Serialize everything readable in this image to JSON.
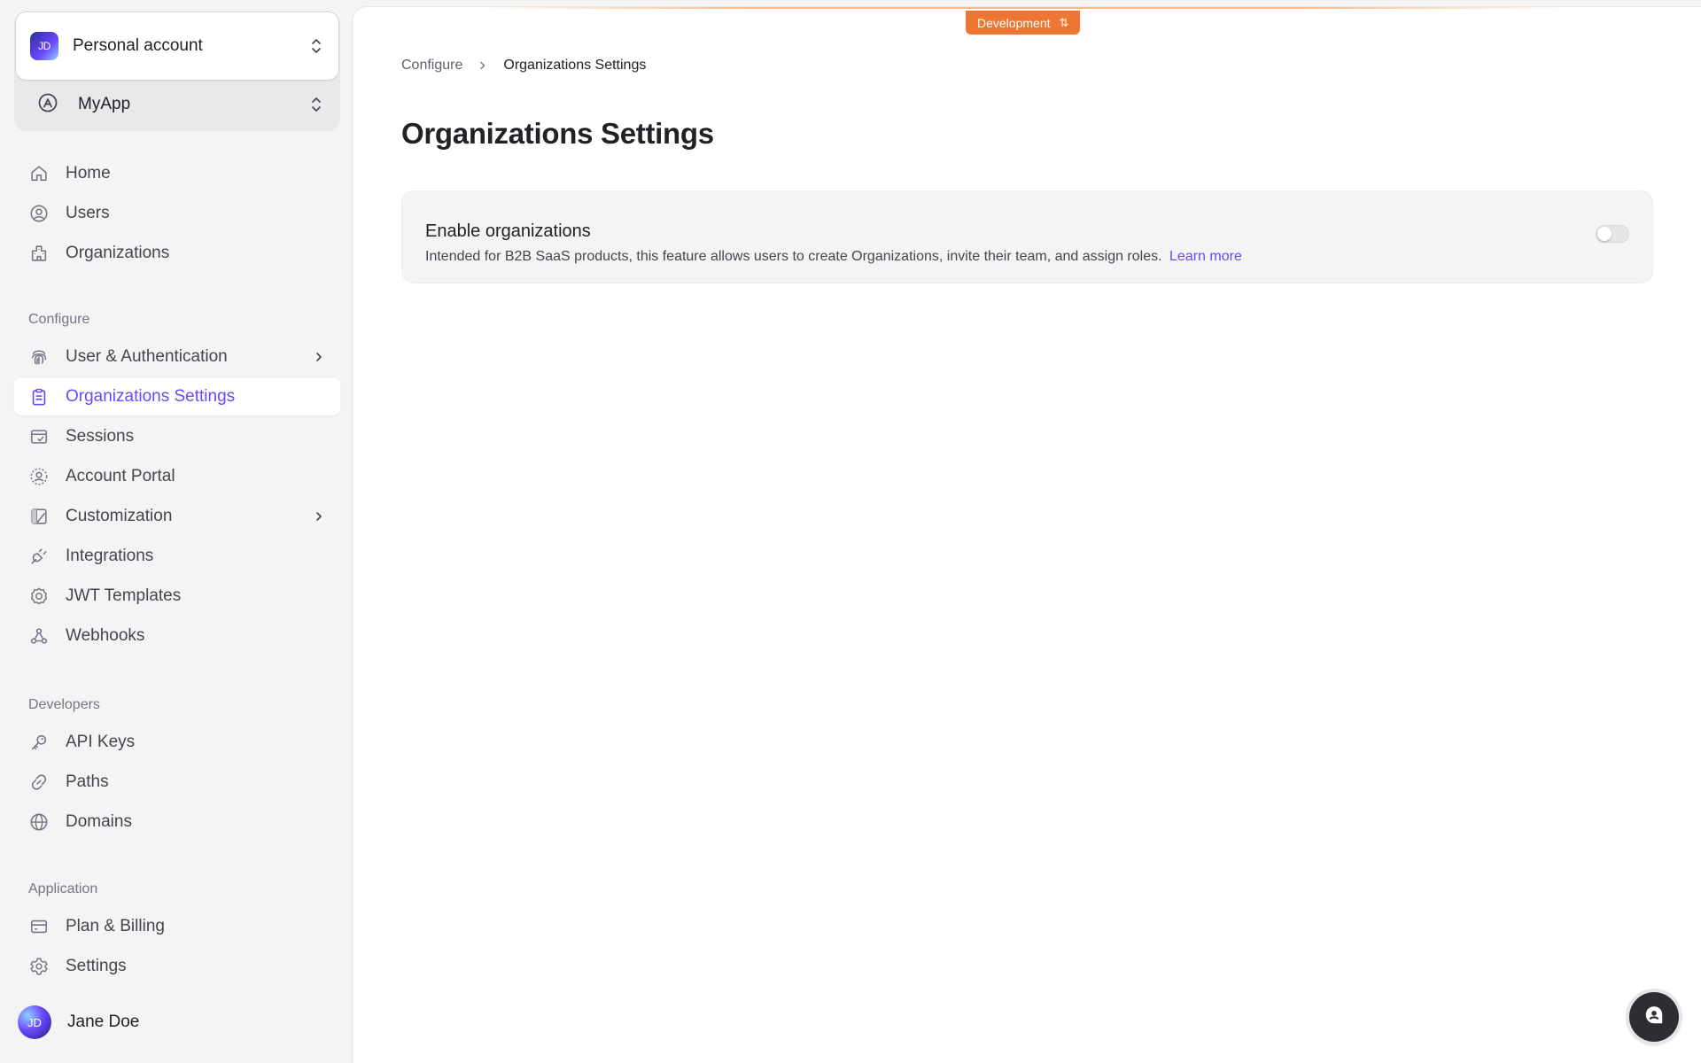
{
  "account": {
    "name": "Personal account",
    "initials": "JD"
  },
  "app": {
    "name": "MyApp"
  },
  "nav_main": [
    {
      "label": "Home",
      "icon": "home-icon"
    },
    {
      "label": "Users",
      "icon": "user-circle-icon"
    },
    {
      "label": "Organizations",
      "icon": "building-icon"
    }
  ],
  "sections": {
    "configure": "Configure",
    "developers": "Developers",
    "application": "Application"
  },
  "nav_configure": [
    {
      "label": "User & Authentication",
      "icon": "fingerprint-icon",
      "has_submenu": true
    },
    {
      "label": "Organizations Settings",
      "icon": "clipboard-icon",
      "active": true
    },
    {
      "label": "Sessions",
      "icon": "sessions-icon"
    },
    {
      "label": "Account Portal",
      "icon": "portal-icon"
    },
    {
      "label": "Customization",
      "icon": "customization-icon",
      "has_submenu": true
    },
    {
      "label": "Integrations",
      "icon": "plug-icon"
    },
    {
      "label": "JWT Templates",
      "icon": "badge-icon"
    },
    {
      "label": "Webhooks",
      "icon": "webhooks-icon"
    }
  ],
  "nav_developers": [
    {
      "label": "API Keys",
      "icon": "key-icon"
    },
    {
      "label": "Paths",
      "icon": "link-icon"
    },
    {
      "label": "Domains",
      "icon": "globe-icon"
    }
  ],
  "nav_application": [
    {
      "label": "Plan & Billing",
      "icon": "credit-card-icon"
    },
    {
      "label": "Settings",
      "icon": "gear-icon"
    }
  ],
  "user": {
    "name": "Jane Doe",
    "initials": "JD"
  },
  "environment": {
    "label": "Development",
    "swap_glyph": "⇅",
    "accent": "#ee7532"
  },
  "breadcrumb": {
    "parent": "Configure",
    "current": "Organizations Settings"
  },
  "page": {
    "title": "Organizations Settings"
  },
  "setting": {
    "title": "Enable organizations",
    "description": "Intended for B2B SaaS products, this feature allows users to create Organizations, invite their team, and assign roles.",
    "link": "Learn more",
    "enabled": false
  },
  "colors": {
    "accent": "#6c47ff",
    "sidebar_bg": "#f4f4f5"
  }
}
